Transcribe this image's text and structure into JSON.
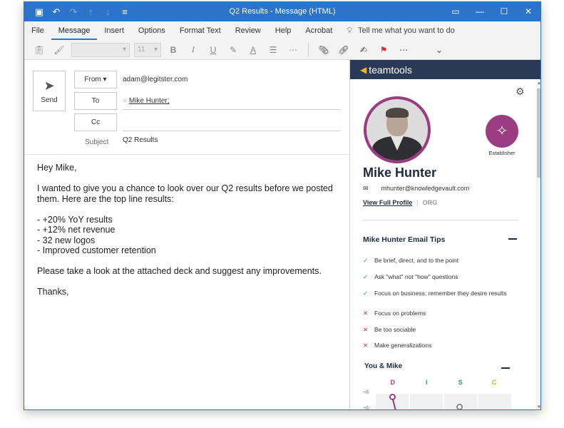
{
  "window": {
    "title": "Q2 Results  -  Message (HTML)"
  },
  "ribbon": {
    "tabs": [
      "File",
      "Message",
      "Insert",
      "Options",
      "Format Text",
      "Review",
      "Help",
      "Acrobat"
    ],
    "active_tab": "Message",
    "tell_me": "Tell me what you want to do",
    "font_size_placeholder": "11"
  },
  "compose": {
    "send_label": "Send",
    "from_label": "From",
    "from_value": "adam@legitster.com",
    "to_label": "To",
    "to_value": "Mike Hunter;",
    "cc_label": "Cc",
    "cc_value": "",
    "subject_label": "Subject",
    "subject_value": "Q2 Results",
    "body": {
      "greeting": "Hey Mike,",
      "intro": "I wanted to give you a chance to look over our Q2 results before we posted them. Here are the top line results:",
      "bullets": [
        "- +20% YoY results",
        "- +12% net revenue",
        "- 32 new logos",
        "- Improved customer retention"
      ],
      "request": "Please take a look at the attached deck and suggest any improvements.",
      "closing": "Thanks,"
    }
  },
  "panel": {
    "brand": "teamtools",
    "profile": {
      "name": "Mike Hunter",
      "email": "mhunter@knowledgevault.com",
      "view_profile": "View Full Profile",
      "org": "ORG",
      "disc_label": "Establisher"
    },
    "tips_title": "Mike Hunter Email Tips",
    "tips": [
      {
        "kind": "do",
        "text": "Be brief, direct, and to the point"
      },
      {
        "kind": "do",
        "text": "Ask \"what\" not \"how\" questions"
      },
      {
        "kind": "do",
        "text": "Focus on business; remember they desire results"
      },
      {
        "kind": "dont",
        "text": "Focus on problems"
      },
      {
        "kind": "dont",
        "text": "Be too sociable"
      },
      {
        "kind": "dont",
        "text": "Make generalizations"
      }
    ],
    "you_and_title": "You & Mike",
    "disc_columns": [
      {
        "letter": "D",
        "color": "#9b3b82"
      },
      {
        "letter": "I",
        "color": "#2e9a49"
      },
      {
        "letter": "S",
        "color": "#2e9a49"
      },
      {
        "letter": "C",
        "color": "#e8a317"
      }
    ],
    "y_ticks": [
      "+8",
      "+6"
    ]
  },
  "colors": {
    "titlebar": "#2b74c9",
    "panel_header": "#2a3a56",
    "accent": "#9b3b82"
  }
}
